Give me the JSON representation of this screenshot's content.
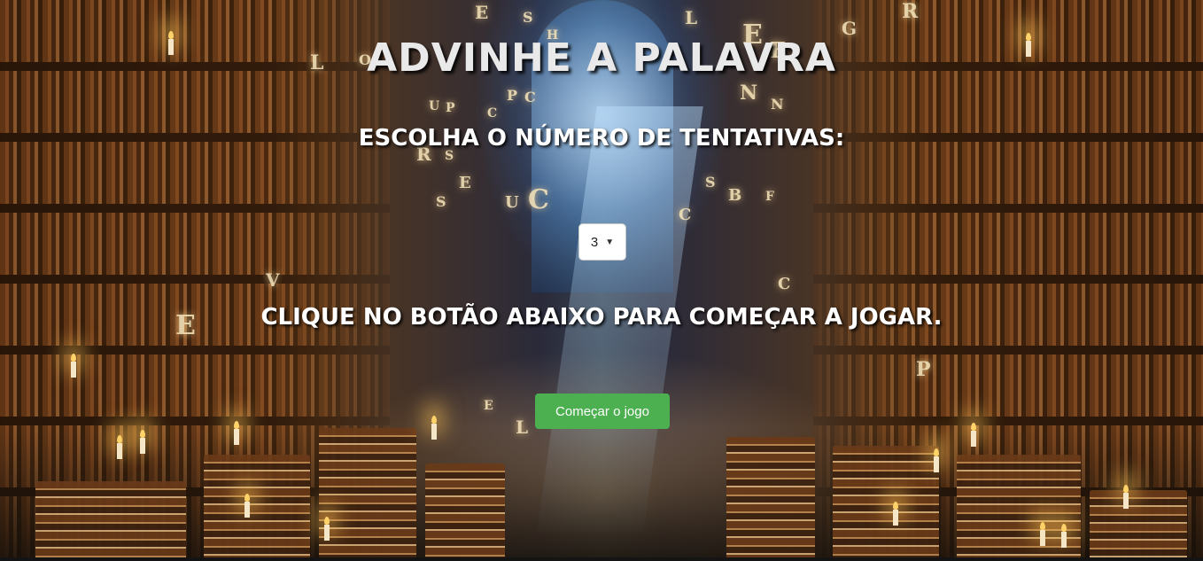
{
  "page": {
    "title": "ADVINHE A PALAVRA",
    "attempts_label": "ESCOLHA O NÚMERO DE TENTATIVAS:",
    "instructions": "CLIQUE NO BOTÃO ABAIXO PARA COMEÇAR A JOGAR."
  },
  "attempts_select": {
    "selected_value": "3",
    "icon": "chevron-down-icon"
  },
  "start_button": {
    "label": "Começar o jogo",
    "color": "#4caf50"
  },
  "background": {
    "description_colors": {
      "text": "#e9e9e9",
      "button": "#4caf50"
    },
    "floating_letters": [
      "E",
      "S",
      "L",
      "H",
      "E",
      "E",
      "L",
      "O",
      "N",
      "P",
      "C",
      "U",
      "P",
      "C",
      "N",
      "R",
      "S",
      "E",
      "U",
      "C",
      "S",
      "B",
      "F",
      "C",
      "S",
      "V",
      "C",
      "E",
      "P",
      "E",
      "L",
      "G",
      "R"
    ]
  }
}
